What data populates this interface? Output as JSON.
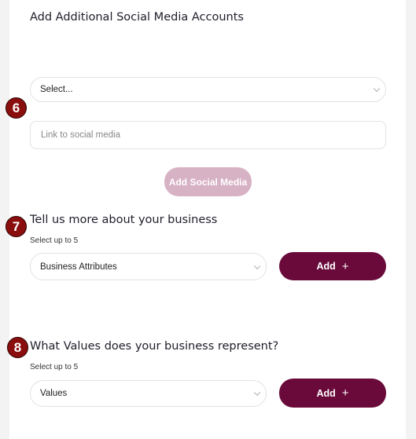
{
  "social": {
    "title": "Add Additional Social Media Accounts",
    "select_value": "Select...",
    "link_placeholder": "Link to social media",
    "add_button": "Add Social Media",
    "step_number": "6"
  },
  "business": {
    "title": "Tell us more about your business",
    "sublabel": "Select up to 5",
    "select_value": "Business Attributes",
    "add_button": "Add",
    "add_icon": "+",
    "step_number": "7"
  },
  "values": {
    "title": "What Values does your business represent?",
    "sublabel": "Select up to 5",
    "select_value": "Values",
    "add_button": "Add",
    "add_icon": "+",
    "step_number": "8"
  },
  "colors": {
    "primary": "#6a0a3a",
    "primary_disabled": "#d7b1c4",
    "step_badge": "#8b0e0e"
  }
}
